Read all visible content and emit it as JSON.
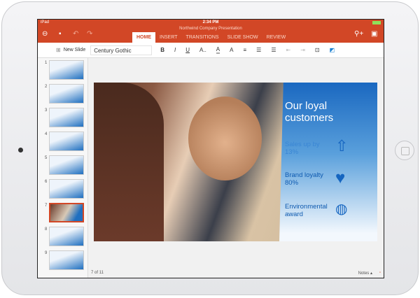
{
  "status": {
    "device": "iPad",
    "time": "2:34 PM"
  },
  "document_title": "Northwind Company Presentation",
  "tabs": [
    "HOME",
    "INSERT",
    "TRANSITIONS",
    "SLIDE SHOW",
    "REVIEW"
  ],
  "active_tab": "HOME",
  "toolbar": {
    "new_slide": "New Slide",
    "font": "Century Gothic",
    "bold": "B",
    "italic": "I",
    "underline": "U",
    "font_size": "A..",
    "font_color": "A",
    "highlight": "A"
  },
  "slides": [
    "1",
    "2",
    "3",
    "4",
    "5",
    "6",
    "7",
    "8",
    "9"
  ],
  "selected_slide": "7",
  "slide": {
    "title": "Our loyal customers",
    "items": [
      {
        "text": "Sales up by 13%",
        "icon": "dollar-up-arrow-icon"
      },
      {
        "text": "Brand loyalty 80%",
        "icon": "heart-icon"
      },
      {
        "text": "Environmental award",
        "icon": "globe-award-icon"
      }
    ]
  },
  "footer": {
    "page": "7 of 11",
    "notes": "Notes"
  },
  "colors": {
    "accent": "#d24726",
    "slide_blue": "#1a68c0"
  }
}
